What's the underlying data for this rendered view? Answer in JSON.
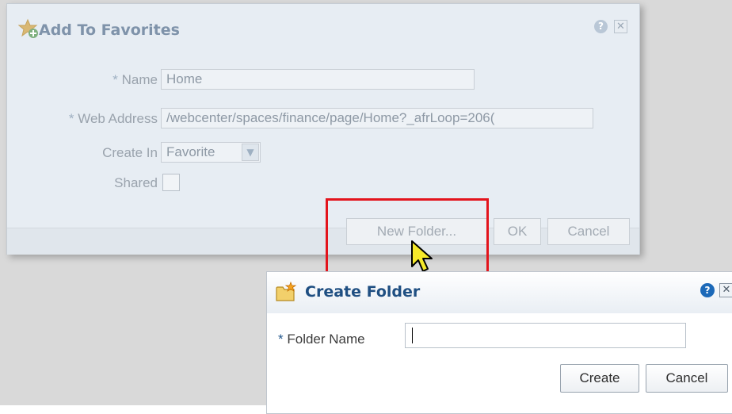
{
  "background_dialog": {
    "title": "Add To Favorites",
    "help_icon": "help-icon",
    "close_icon": "close-icon",
    "fields": {
      "name_label": "Name",
      "name_value": "Home",
      "web_address_label": "Web Address",
      "web_address_value": "/webcenter/spaces/finance/page/Home?_afrLoop=206(",
      "create_in_label": "Create In",
      "create_in_value": "Favorite",
      "shared_label": "Shared",
      "shared_checked": false,
      "required_marker": "*"
    },
    "buttons": {
      "new_folder": "New Folder...",
      "ok": "OK",
      "cancel": "Cancel"
    }
  },
  "create_folder_dialog": {
    "title": "Create Folder",
    "help_icon": "help-icon",
    "close_icon": "close-icon",
    "folder_name_label": "Folder Name",
    "required_marker": "*",
    "folder_name_value": "",
    "buttons": {
      "create": "Create",
      "cancel": "Cancel"
    }
  },
  "colors": {
    "highlight": "#e3141c",
    "title_blue": "#1f4f82"
  }
}
